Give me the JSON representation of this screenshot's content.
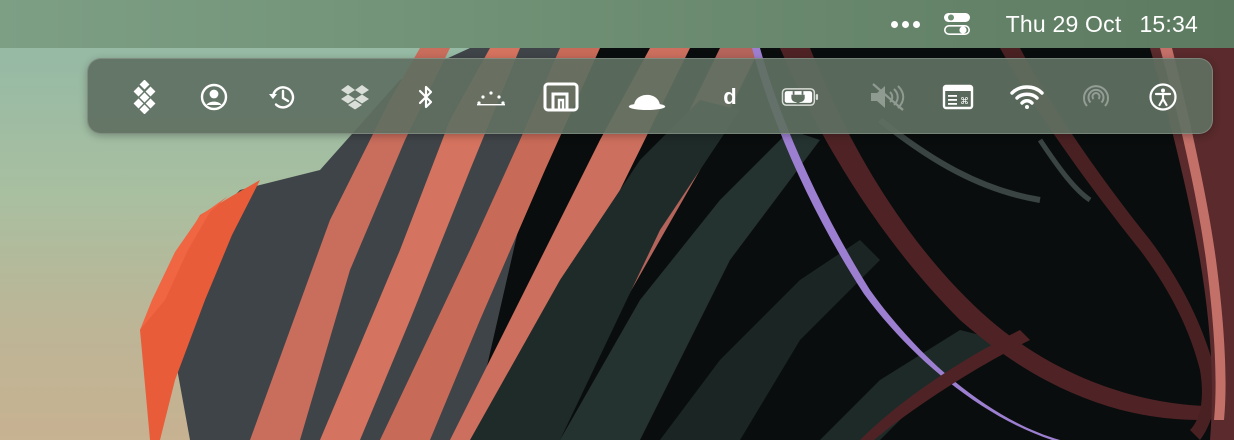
{
  "menubar": {
    "date": "Thu 29 Oct",
    "time": "15:34",
    "items": [
      {
        "name": "more-dots-icon"
      },
      {
        "name": "control-center-icon"
      }
    ]
  },
  "overflow_bar": {
    "icons": [
      {
        "name": "diamond-grid-icon",
        "interactable": true
      },
      {
        "name": "user-account-icon",
        "interactable": true
      },
      {
        "name": "time-machine-icon",
        "interactable": true
      },
      {
        "name": "dropbox-icon",
        "interactable": true
      },
      {
        "name": "bluetooth-icon",
        "interactable": true
      },
      {
        "name": "dotted-arc-icon",
        "interactable": true
      },
      {
        "name": "window-arrange-icon",
        "interactable": true
      },
      {
        "name": "bowler-hat-icon",
        "interactable": true
      },
      {
        "name": "d-letter-icon",
        "label": "d",
        "interactable": true
      },
      {
        "name": "battery-charging-icon",
        "interactable": true
      },
      {
        "name": "volume-muted-icon",
        "interactable": true
      },
      {
        "name": "keyboard-shortcut-icon",
        "interactable": true
      },
      {
        "name": "wifi-icon",
        "interactable": true
      },
      {
        "name": "airdrop-icon",
        "interactable": true
      },
      {
        "name": "accessibility-icon",
        "interactable": true
      }
    ]
  },
  "colors": {
    "menubar_start": "#7d9f84",
    "menubar_end": "#5c7a60",
    "wallpaper_orange": "#e85c3a",
    "wallpaper_salmon": "#cf6e5e",
    "wallpaper_dark": "#2a3533",
    "wallpaper_maroon": "#4f2325",
    "wallpaper_purple": "#9d7fd1"
  }
}
